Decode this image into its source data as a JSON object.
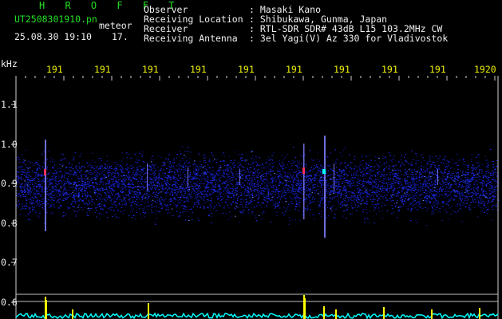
{
  "header": {
    "program_name": "H R O F F T",
    "file_name": "UT2508301910.pn",
    "mode_label": "meteor",
    "datetime": "25.08.30 19:10",
    "meteor_count": "17.",
    "info": [
      {
        "label": "Observer",
        "value": ": Masaki Kano"
      },
      {
        "label": "Receiving Location",
        "value": ": Shibukawa, Gunma, Japan"
      },
      {
        "label": "Receiver",
        "value": ": RTL-SDR SDR# 43dB L15 103.2MHz CW"
      },
      {
        "label": "Receiving Antenna",
        "value": ": 3el Yagi(V) Az 330 for Vladivostok"
      }
    ]
  },
  "axes": {
    "unit": "kHz",
    "time_ticks": [
      "191",
      "191",
      "191",
      "191",
      "191",
      "191",
      "191",
      "191",
      "191",
      "1920"
    ],
    "freq_ticks": [
      "1.1",
      "1.0",
      "0.9",
      "0.8",
      "0.7",
      "0.6"
    ]
  },
  "colors": {
    "header_green": "#22e022",
    "label_white": "#f0f0f0",
    "tick_yellow": "#f0f000",
    "noise_blue": "#2030ff",
    "echo_yellow": "#ffff00",
    "level_cyan": "#00ffff"
  }
}
